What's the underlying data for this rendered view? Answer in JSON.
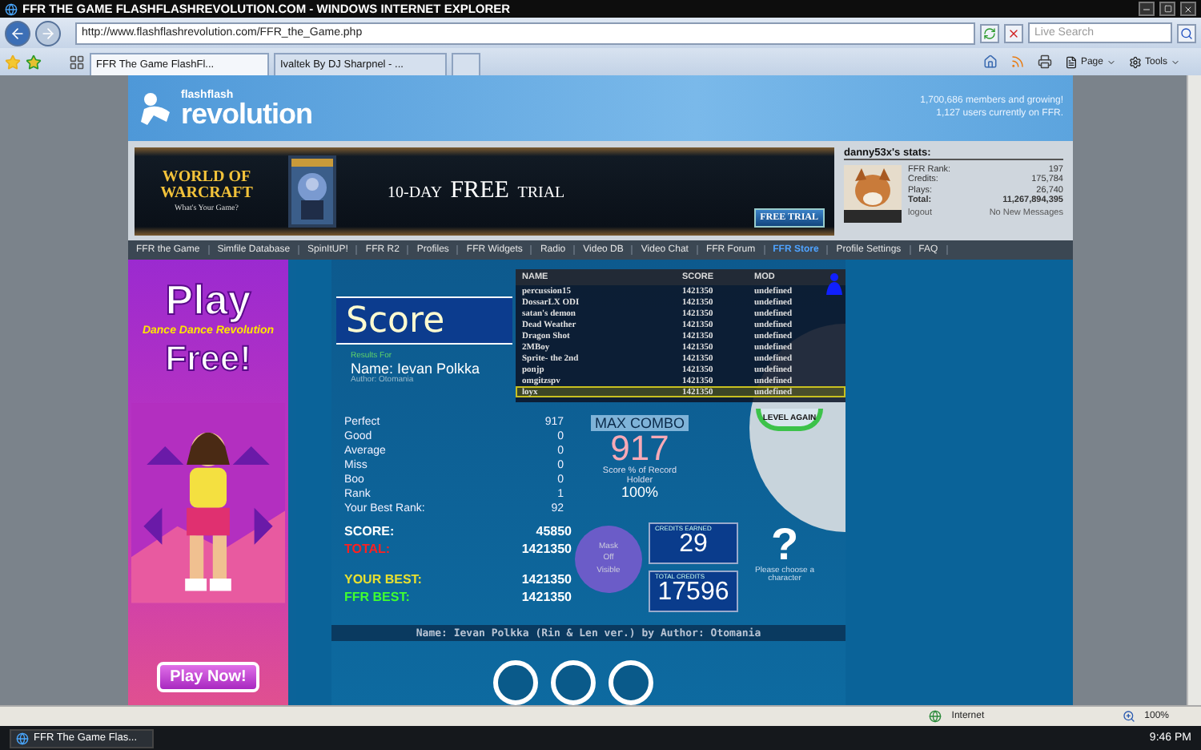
{
  "window": {
    "title": "FFR THE GAME FLASHFLASHREVOLUTION.COM - WINDOWS INTERNET EXPLORER"
  },
  "address_bar": {
    "url": "http://www.flashflashrevolution.com/FFR_the_Game.php"
  },
  "search": {
    "placeholder": "Live Search"
  },
  "tabs": [
    {
      "label": "FFR The Game FlashFl...",
      "selected": true
    },
    {
      "label": "Ivaltek By DJ Sharpnel - ...",
      "selected": false
    }
  ],
  "command_bar": [
    "Page",
    "Tools"
  ],
  "site": {
    "logo_top": "flashflash",
    "logo_main": "revolution",
    "members": "1,700,686 members and growing!",
    "online": "1,127 users currently on FFR."
  },
  "banner": {
    "logo": "WORLD OF WARCRAFT",
    "tagline": "What's Your Game?",
    "headline": "10-DAY **FREE** TRIAL",
    "button": "FREE TRIAL"
  },
  "user_stats": {
    "title": "danny53x's stats:",
    "rows": [
      {
        "label": "FFR Rank:",
        "value": "197",
        "bold": false
      },
      {
        "label": "Credits:",
        "value": "175,784",
        "bold": false
      },
      {
        "label": "Plays:",
        "value": "26,740",
        "bold": false
      },
      {
        "label": "Total:",
        "value": "11,267,894,395",
        "bold": true
      }
    ],
    "logout": "logout",
    "messages": "No New Messages"
  },
  "nav": [
    {
      "label": "FFR the Game",
      "selected": false
    },
    {
      "label": "Simfile Database",
      "selected": false
    },
    {
      "label": "SpinItUP!",
      "selected": false
    },
    {
      "label": "FFR R2",
      "selected": false
    },
    {
      "label": "Profiles",
      "selected": false
    },
    {
      "label": "FFR Widgets",
      "selected": false
    },
    {
      "label": "Radio",
      "selected": false
    },
    {
      "label": "Video DB",
      "selected": false
    },
    {
      "label": "Video Chat",
      "selected": false
    },
    {
      "label": "FFR Forum",
      "selected": false
    },
    {
      "label": "FFR Store",
      "selected": true
    },
    {
      "label": "Profile Settings",
      "selected": false
    },
    {
      "label": "FAQ",
      "selected": false
    }
  ],
  "side_ad": {
    "title": "Play",
    "brand": "Dance Dance Revolution",
    "subtitle": "Free!",
    "button": "Play Now!"
  },
  "game": {
    "score_title": "Score",
    "results_label": "Results For",
    "song_name": "Name: Ievan Polkka",
    "author": "Author: Otomania",
    "judgements": [
      {
        "label": "Perfect",
        "value": "917"
      },
      {
        "label": "Good",
        "value": "0"
      },
      {
        "label": "Average",
        "value": "0"
      },
      {
        "label": "Miss",
        "value": "0"
      },
      {
        "label": "Boo",
        "value": "0"
      },
      {
        "label": "Rank",
        "value": "1"
      }
    ],
    "best_rank": {
      "label": "Your Best Rank:",
      "value": "92"
    },
    "combo": {
      "label": "MAX COMBO",
      "value": "917",
      "record_label": "Score % of Record Holder",
      "record_value": "100%"
    },
    "totals": [
      {
        "label": "SCORE:",
        "value": "45850",
        "color": "#ffffff"
      },
      {
        "label": "TOTAL:",
        "value": "1421350",
        "color": "#ff2020"
      },
      {
        "label": "YOUR BEST:",
        "value": "1421350",
        "color": "#e8e030"
      },
      {
        "label": "FFR BEST:",
        "value": "1421350",
        "color": "#40ff30"
      }
    ],
    "mask": [
      "Mask",
      "Off",
      "Visible"
    ],
    "credits_earned": {
      "label": "CREDITS EARNED",
      "value": "29"
    },
    "total_credits": {
      "label": "TOTAL CREDITS",
      "value": "17596"
    },
    "character": {
      "symbol": "?",
      "prompt": "Please choose a character"
    },
    "footer": "Name: Ievan Polkka (Rin & Len ver.) by Author: Otomania",
    "retry_button": "LEVEL AGAIN",
    "leaderboard": {
      "columns": [
        "NAME",
        "SCORE",
        "MOD"
      ],
      "rows": [
        {
          "name": "percussion15",
          "score": "1421350",
          "mode": "undefined",
          "selected": false
        },
        {
          "name": "DossarLX ODI",
          "score": "1421350",
          "mode": "undefined",
          "selected": false
        },
        {
          "name": "satan's demon",
          "score": "1421350",
          "mode": "undefined",
          "selected": false
        },
        {
          "name": "Dead Weather",
          "score": "1421350",
          "mode": "undefined",
          "selected": false
        },
        {
          "name": "Dragon Shot",
          "score": "1421350",
          "mode": "undefined",
          "selected": false
        },
        {
          "name": "2MBoy",
          "score": "1421350",
          "mode": "undefined",
          "selected": false
        },
        {
          "name": "Sprite- the 2nd",
          "score": "1421350",
          "mode": "undefined",
          "selected": false
        },
        {
          "name": "ponjp",
          "score": "1421350",
          "mode": "undefined",
          "selected": false
        },
        {
          "name": "omgitzspv",
          "score": "1421350",
          "mode": "undefined",
          "selected": false
        },
        {
          "name": "loyx",
          "score": "1421350",
          "mode": "undefined",
          "selected": true
        }
      ]
    }
  },
  "status_bar": {
    "zone": "Internet",
    "zoom": "100%"
  },
  "taskbar": {
    "window": "FFR The Game Flas...",
    "clock": "9:46 PM"
  }
}
